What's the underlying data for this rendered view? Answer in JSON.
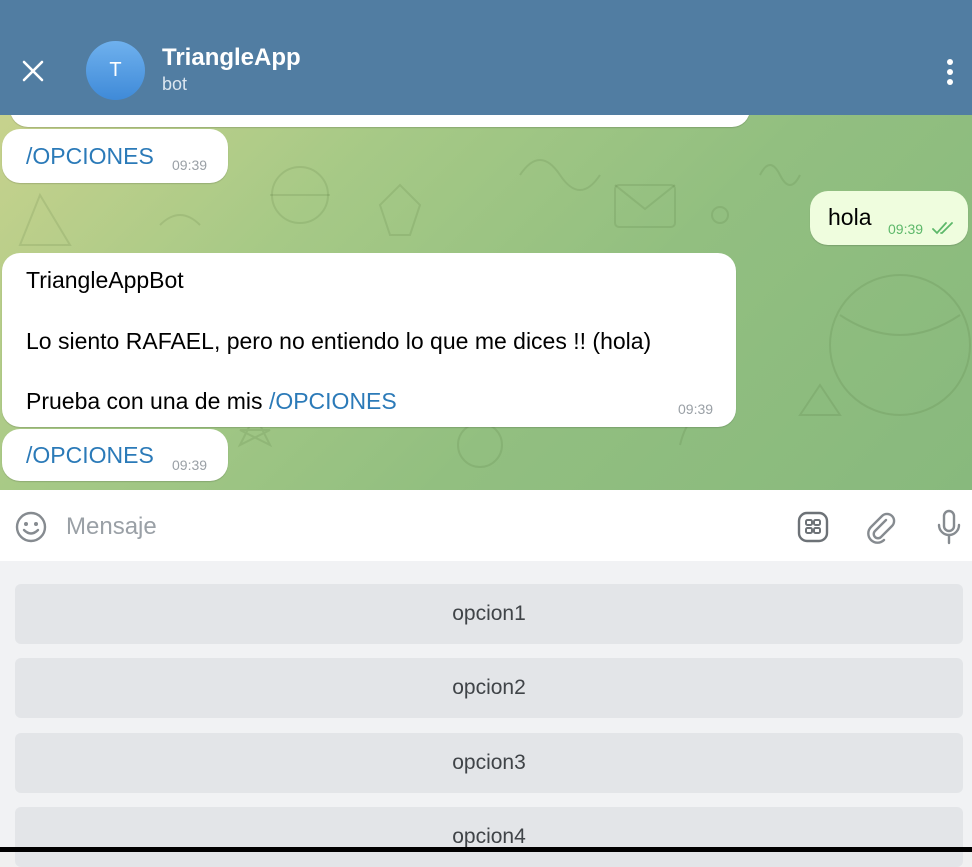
{
  "header": {
    "avatar_letter": "T",
    "title": "TriangleApp",
    "subtitle": "bot",
    "close_icon": "close-icon",
    "menu_icon": "more-vertical-icon"
  },
  "messages": {
    "m1": {
      "text": "/OPCIONES",
      "time": "09:39"
    },
    "m2": {
      "text": "hola",
      "time": "09:39",
      "status": "read"
    },
    "m3": {
      "line1": "TriangleAppBot",
      "line2": "Lo siento RAFAEL, pero no entiendo lo que me dices !! (hola)",
      "line3_prefix": "Prueba con una de mis ",
      "line3_link": "/OPCIONES",
      "time": "09:39"
    },
    "m4": {
      "text": "/OPCIONES",
      "time": "09:39"
    }
  },
  "input": {
    "placeholder": "Mensaje",
    "value": "",
    "emoji_icon": "emoji-icon",
    "keyboard_icon": "bot-keyboard-icon",
    "attach_icon": "paperclip-icon",
    "mic_icon": "microphone-icon"
  },
  "keyboard": {
    "buttons": [
      "opcion1",
      "opcion2",
      "opcion3",
      "opcion4"
    ]
  },
  "colors": {
    "header": "#517da2",
    "link": "#2b7ab8",
    "outgoing_bubble": "#effdde",
    "read_check": "#5db86a"
  }
}
